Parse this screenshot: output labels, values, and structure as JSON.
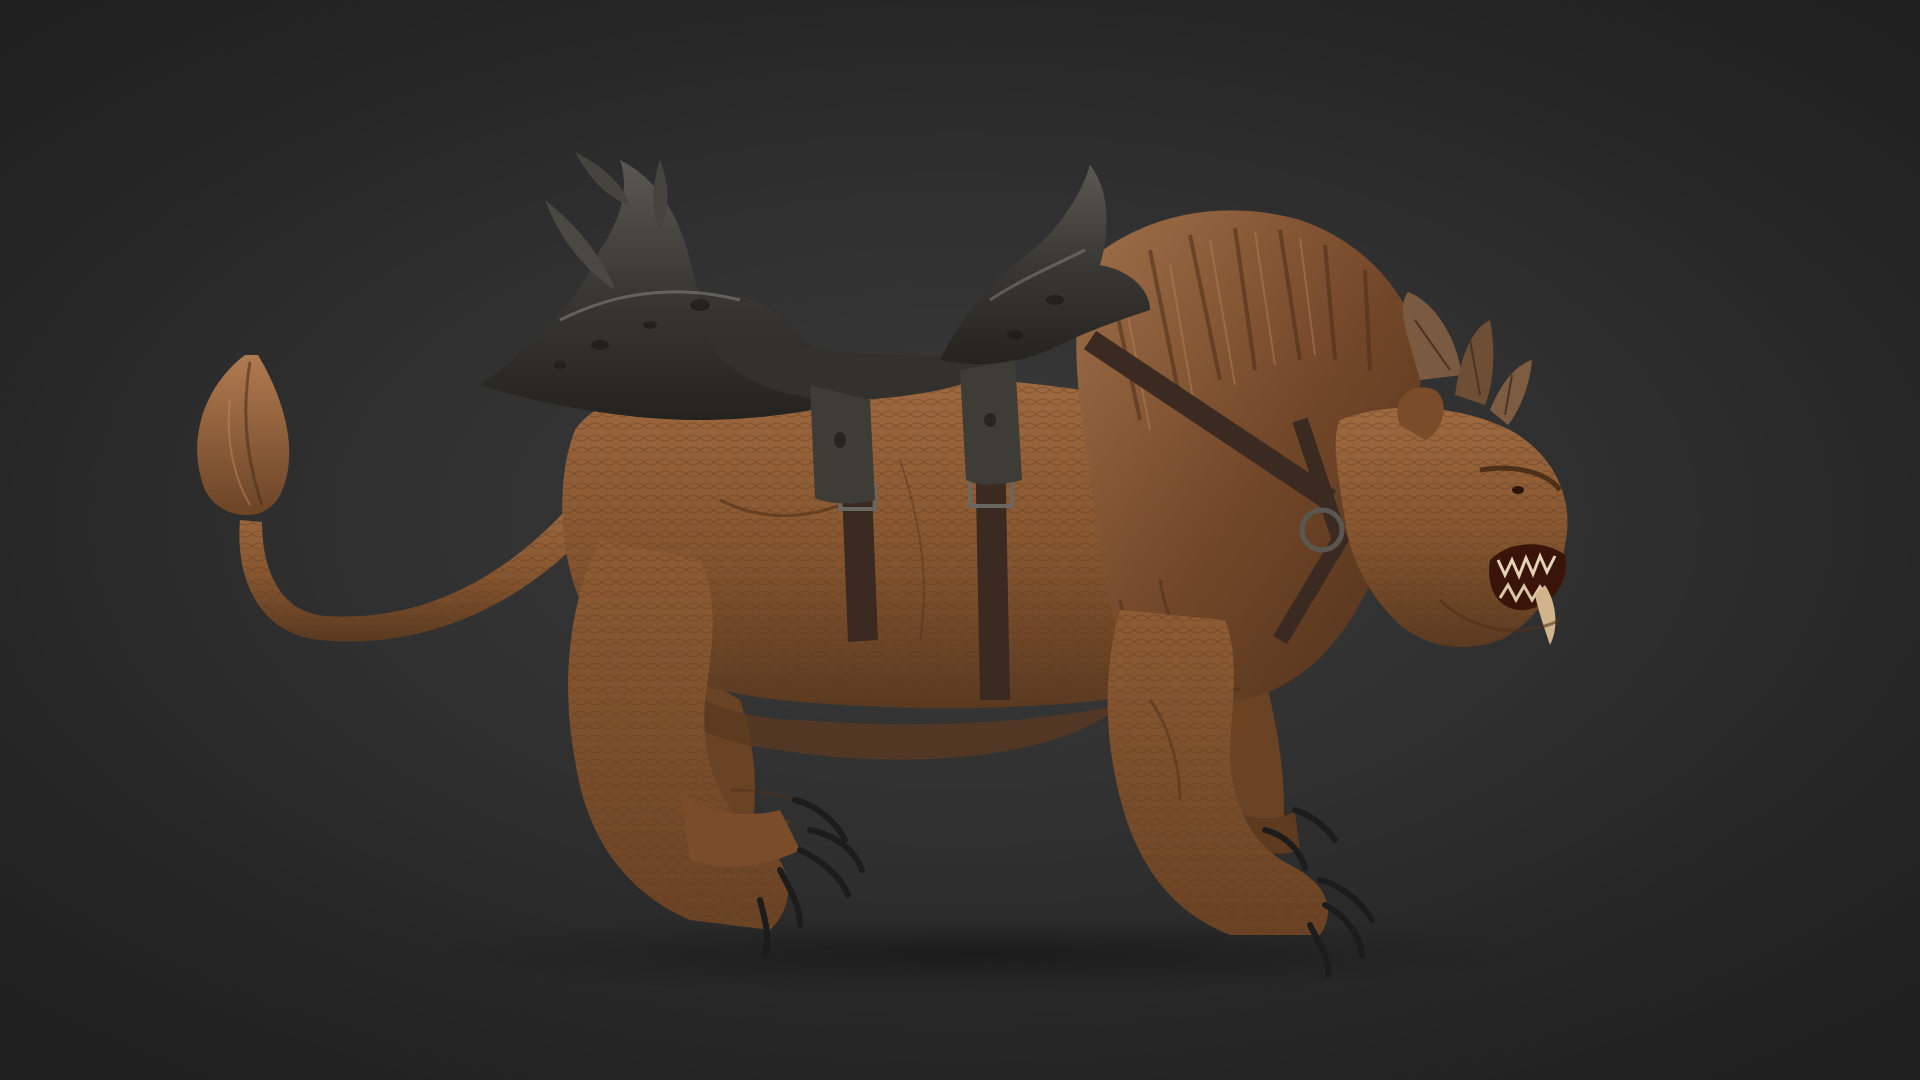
{
  "viewport": {
    "background": "#2c2c2c",
    "subject": "beast-with-saddle-3d-model"
  },
  "colors": {
    "hide": "#8a5a34",
    "hide_shadow": "#5e3a1f",
    "hide_highlight": "#a8724a",
    "mane": "#6e4627",
    "mane_highlight": "#9a6a45",
    "saddle_iron": "#3c3a36",
    "saddle_highlight": "#6f6c66",
    "strap": "#3a2a22",
    "claw": "#1e1e1e",
    "horn": "#7a5a40"
  }
}
